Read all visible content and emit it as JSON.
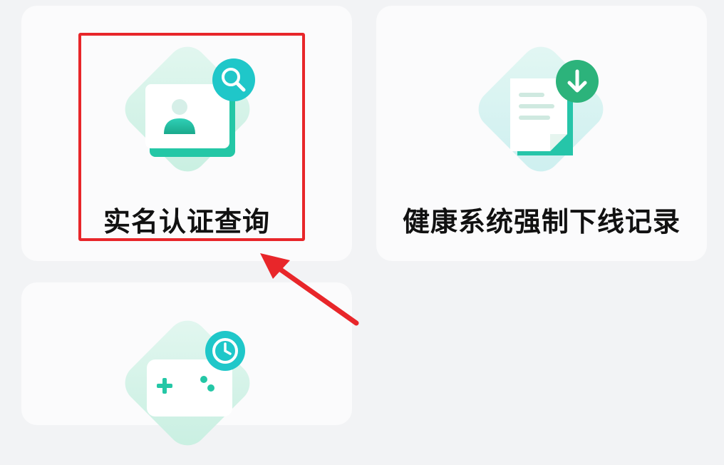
{
  "cards": [
    {
      "label": "实名认证查询",
      "icon": "id-search-icon"
    },
    {
      "label": "健康系统强制下线记录",
      "icon": "document-download-icon"
    },
    {
      "label": "",
      "icon": "gamepad-clock-icon"
    }
  ],
  "annotation": {
    "highlight_color": "#e8262a",
    "arrow_color": "#e8262a"
  },
  "colors": {
    "accent_teal": "#1fc7c9",
    "accent_green": "#2cb37b",
    "tile_bg": "#d9f3ea"
  }
}
